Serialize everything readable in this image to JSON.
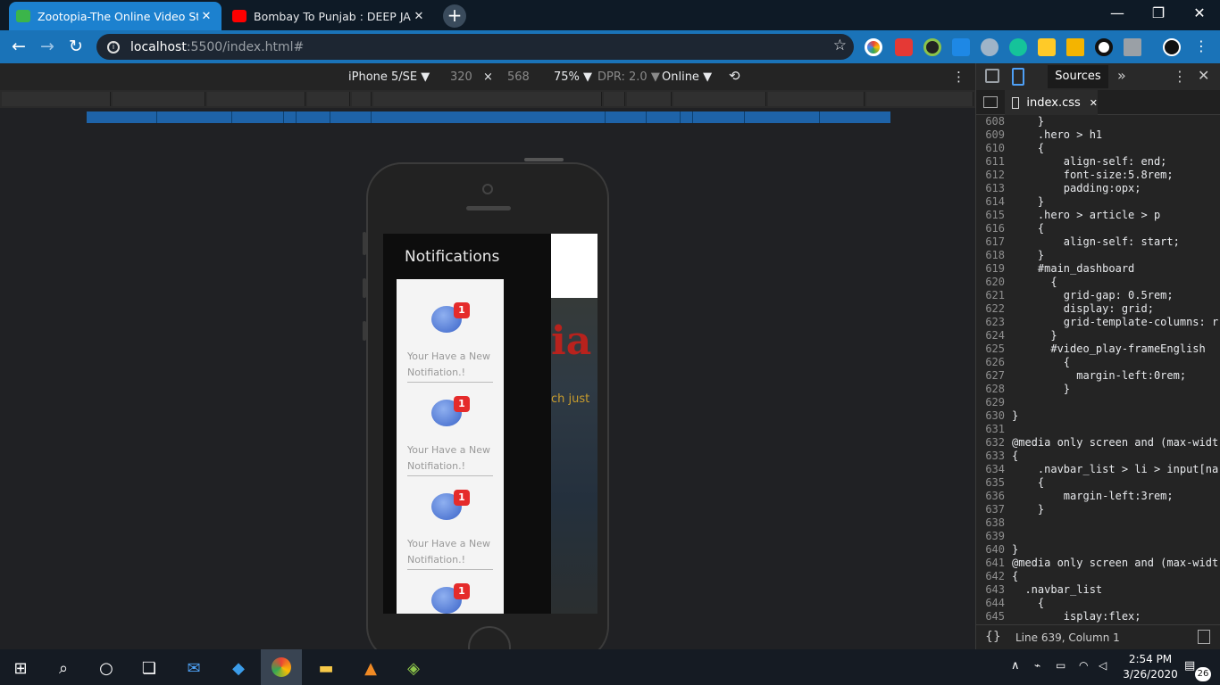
{
  "browser": {
    "tabs": [
      {
        "title": "Zootopia-The Online Video Strea",
        "active": true
      },
      {
        "title": "Bombay To Punjab : DEEP JANDU",
        "active": false
      }
    ],
    "new_tab_icon": "+",
    "window_controls": {
      "minimize": "—",
      "maximize": "❐",
      "close": "✕"
    },
    "url_host": "localhost",
    "url_rest": ":5500/index.html#"
  },
  "device_toolbar": {
    "device": "iPhone 5/SE",
    "width": "320",
    "times": "×",
    "height": "568",
    "zoom": "75%",
    "dpr": "DPR: 2.0",
    "network": "Online"
  },
  "page": {
    "notifications_title": "Notifications",
    "card_badge": "1",
    "cards": [
      {
        "line1": "Your Have a New",
        "line2": "Notifiation.!"
      },
      {
        "line1": "Your Have a New",
        "line2": "Notifiation.!"
      },
      {
        "line1": "Your Have a New",
        "line2": "Notifiation.!"
      },
      {
        "line1": "",
        "line2": ""
      }
    ],
    "hero_fragment": "ia",
    "hero_sub_fragment": "ch just"
  },
  "devtools": {
    "panel": "Sources",
    "more": "»",
    "file_tab": "index.css",
    "code_lines": [
      {
        "n": "608",
        "t": "    }"
      },
      {
        "n": "609",
        "t": "    .hero > h1"
      },
      {
        "n": "610",
        "t": "    {"
      },
      {
        "n": "611",
        "t": "        align-self: end;"
      },
      {
        "n": "612",
        "t": "        font-size:5.8rem;"
      },
      {
        "n": "613",
        "t": "        padding:opx;"
      },
      {
        "n": "614",
        "t": "    }"
      },
      {
        "n": "615",
        "t": "    .hero > article > p"
      },
      {
        "n": "616",
        "t": "    {"
      },
      {
        "n": "617",
        "t": "        align-self: start;"
      },
      {
        "n": "618",
        "t": "    }"
      },
      {
        "n": "619",
        "t": "    #main_dashboard"
      },
      {
        "n": "620",
        "t": "      {"
      },
      {
        "n": "621",
        "t": "        grid-gap: 0.5rem;"
      },
      {
        "n": "622",
        "t": "        display: grid;"
      },
      {
        "n": "623",
        "t": "        grid-template-columns: r"
      },
      {
        "n": "624",
        "t": "      }"
      },
      {
        "n": "625",
        "t": "      #video_play-frameEnglish"
      },
      {
        "n": "626",
        "t": "        {"
      },
      {
        "n": "627",
        "t": "          margin-left:0rem;"
      },
      {
        "n": "628",
        "t": "        }"
      },
      {
        "n": "629",
        "t": ""
      },
      {
        "n": "630",
        "t": "}"
      },
      {
        "n": "631",
        "t": ""
      },
      {
        "n": "632",
        "t": "@media only screen and (max-widt"
      },
      {
        "n": "633",
        "t": "{"
      },
      {
        "n": "634",
        "t": "    .navbar_list > li > input[na"
      },
      {
        "n": "635",
        "t": "    {"
      },
      {
        "n": "636",
        "t": "        margin-left:3rem;"
      },
      {
        "n": "637",
        "t": "    }"
      },
      {
        "n": "638",
        "t": ""
      },
      {
        "n": "639",
        "t": ""
      },
      {
        "n": "640",
        "t": "}"
      },
      {
        "n": "641",
        "t": "@media only screen and (max-widt"
      },
      {
        "n": "642",
        "t": "{"
      },
      {
        "n": "643",
        "t": "  .navbar_list"
      },
      {
        "n": "644",
        "t": "    {"
      },
      {
        "n": "645",
        "t": "        isplay:flex;"
      }
    ],
    "status": "Line 639, Column 1",
    "braces": "{}"
  },
  "taskbar": {
    "time": "2:54 PM",
    "date": "3/26/2020",
    "notifications": "26"
  },
  "colors": {
    "tab_active": "#1c81cf",
    "toolbar": "#1a73b8",
    "hero_red": "#b8221d",
    "badge": "#e52b2b"
  }
}
